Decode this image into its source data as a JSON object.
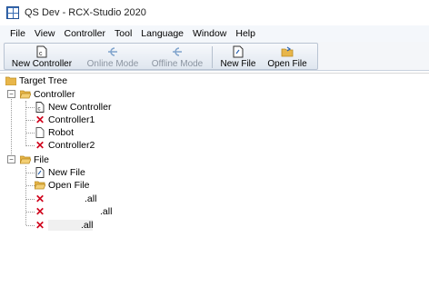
{
  "window": {
    "title": "QS Dev - RCX-Studio 2020"
  },
  "menu": {
    "items": [
      "File",
      "View",
      "Controller",
      "Tool",
      "Language",
      "Window",
      "Help"
    ]
  },
  "toolbar": {
    "buttons": [
      {
        "label": "New Controller",
        "icon": "new-controller-icon",
        "enabled": true
      },
      {
        "label": "Online Mode",
        "icon": "online-mode-icon",
        "enabled": false
      },
      {
        "label": "Offline Mode",
        "icon": "offline-mode-icon",
        "enabled": false
      },
      {
        "label": "New File",
        "icon": "new-file-icon",
        "enabled": true
      },
      {
        "label": "Open File",
        "icon": "open-file-icon",
        "enabled": true
      }
    ]
  },
  "tree": {
    "root": "Target Tree",
    "controller_group": {
      "label": "Controller",
      "children": [
        {
          "label": "New Controller",
          "icon": "controller-doc-icon"
        },
        {
          "label": "Controller1",
          "icon": "error-x-icon"
        },
        {
          "label": "Robot",
          "icon": "blank-doc-icon"
        },
        {
          "label": "Controller2",
          "icon": "error-x-icon"
        }
      ]
    },
    "file_group": {
      "label": "File",
      "children": [
        {
          "label": "New File",
          "icon": "new-file-icon"
        },
        {
          "label": "Open File",
          "icon": "folder-icon"
        },
        {
          "label": ".all",
          "icon": "error-x-icon"
        },
        {
          "label": ".all",
          "icon": "error-x-icon"
        },
        {
          "label": ".all",
          "icon": "error-x-icon"
        }
      ]
    }
  },
  "colors": {
    "error": "#d0021b",
    "folder": "#e8b64a",
    "toolbar_border": "#b9c4d3",
    "disabled_text": "#8c95a1"
  }
}
